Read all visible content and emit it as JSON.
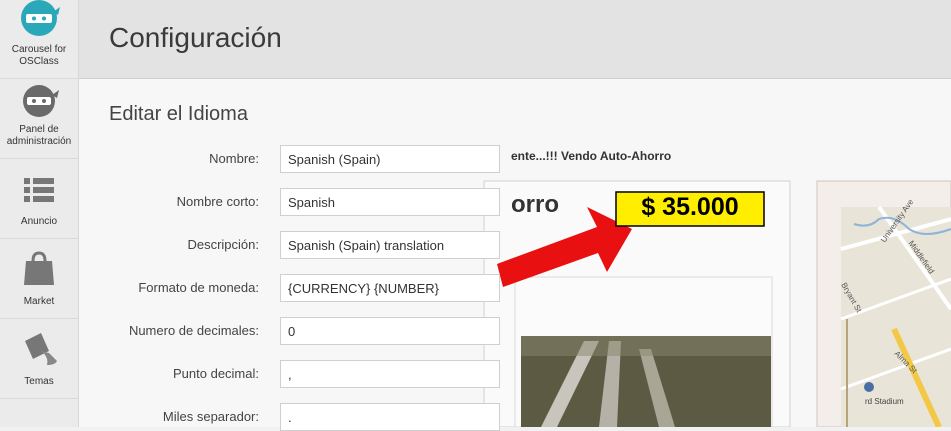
{
  "sidebar": {
    "items": [
      {
        "label": "Carousel for OSClass",
        "icon": "ninja-icon"
      },
      {
        "label": "Panel de administración",
        "icon": "ninja-icon"
      },
      {
        "label": "Anuncio",
        "icon": "list-icon"
      },
      {
        "label": "Market",
        "icon": "shopping-bag-icon"
      },
      {
        "label": "Temas",
        "icon": "paint-bucket-icon"
      }
    ]
  },
  "header": {
    "title": "Configuración"
  },
  "form": {
    "title": "Editar el Idioma",
    "fields": [
      {
        "label": "Nombre:",
        "value": "Spanish (Spain)"
      },
      {
        "label": "Nombre corto:",
        "value": "Spanish"
      },
      {
        "label": "Descripción:",
        "value": "Spanish (Spain) translation"
      },
      {
        "label": "Formato de moneda:",
        "value": "{CURRENCY} {NUMBER}"
      },
      {
        "label": "Numero de decimales:",
        "value": "0"
      },
      {
        "label": "Punto decimal:",
        "value": ","
      },
      {
        "label": "Miles separador:",
        "value": "."
      }
    ]
  },
  "overlay": {
    "headline": "ente...!!! Vendo Auto-Ahorro",
    "subtitle": "orro",
    "price": "$ 35.000",
    "price_bg": "#ffee00",
    "arrow_color": "#e81010",
    "map_labels": [
      "University Ave",
      "Middlefield",
      "Alma St",
      "Bryant St",
      "rd Stadium"
    ]
  },
  "colors": {
    "accent": "#29a9b9",
    "sidebar_bg": "#ebebeb",
    "header_bg": "#e3e3e3"
  }
}
